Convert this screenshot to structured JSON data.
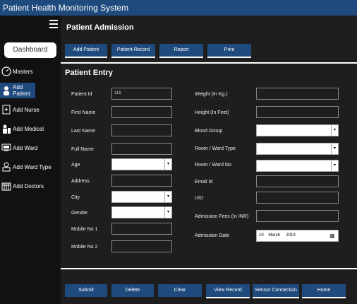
{
  "app": {
    "title": "Patient Health Monitoring System"
  },
  "sidebar": {
    "dashboard_label": "Dashboard",
    "items": [
      {
        "label": "Masters",
        "icon": "gauge-icon"
      },
      {
        "label": "Add Patient",
        "icon": "patient-icon"
      },
      {
        "label": "Add Nurse",
        "icon": "nurse-icon"
      },
      {
        "label": "Add Medical",
        "icon": "medical-icon"
      },
      {
        "label": "Add Ward",
        "icon": "ward-icon"
      },
      {
        "label": "Add Ward Type",
        "icon": "ward-type-icon"
      },
      {
        "label": "Add Doctors",
        "icon": "doctors-icon"
      }
    ],
    "active_index": 1
  },
  "main": {
    "title": "Patient Admission",
    "tabs": [
      "Add Patient",
      "Patient Record",
      "Report",
      "Print"
    ],
    "section_title": "Patient Entry"
  },
  "form": {
    "patient_id_label": "Patient Id",
    "patient_id_value": "116",
    "first_name_label": "First Name",
    "last_name_label": "Last Name",
    "full_name_label": "Full Name",
    "age_label": "Age",
    "address_label": "Address",
    "city_label": "City",
    "gender_label": "Gender",
    "mobile1_label": "Mobile No 1",
    "mobile2_label": "Mobile No 2",
    "weight_label": "Weight   (In Kg.)",
    "height_label": "Height   (In Feet)",
    "blood_group_label": "Blood Group",
    "room_type_label": "Room / Ward Type",
    "room_no_label": "Room / Ward No",
    "email_label": "Email Id",
    "uid_label": "UID",
    "fees_label": "Admission Fees   (In INR)",
    "date_label": "Admission Date",
    "date_day": "10",
    "date_month": "March",
    "date_year": "2019"
  },
  "buttons": {
    "submit": "Submit",
    "delete": "Delete",
    "clear": "Clear",
    "view_record": "View Record",
    "sensor": "Sensor Connection",
    "home": "Home"
  },
  "colors": {
    "accent": "#1f4a7d",
    "background": "#1e1e1e",
    "sidebar": "#111111"
  }
}
